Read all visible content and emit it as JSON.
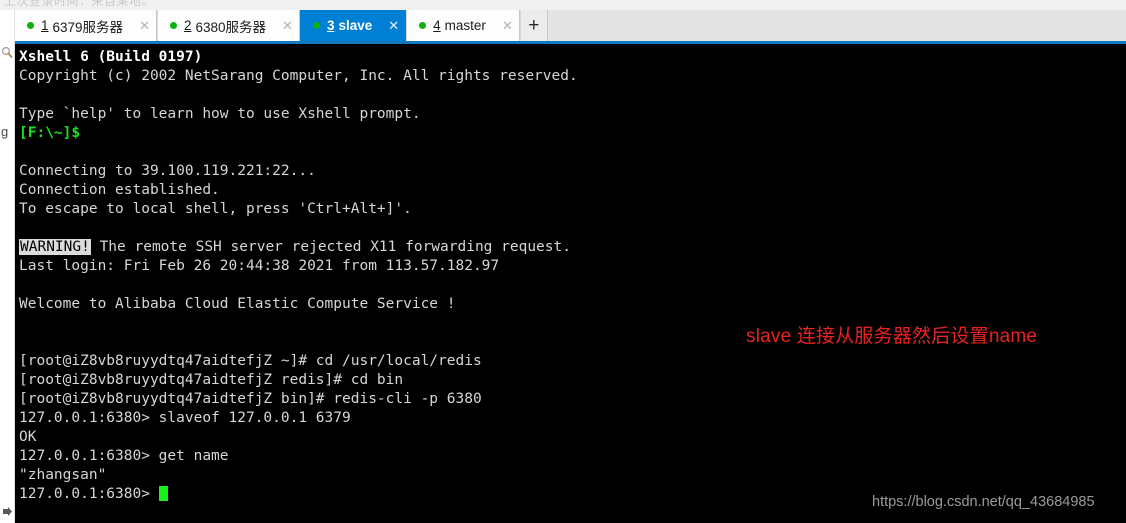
{
  "window": {
    "clipped_top_text": "上次登录时间：来自某地。"
  },
  "left_rail": {
    "search_icon": "search-icon",
    "letter": "g",
    "arrow_icon": "arrow-right-icon"
  },
  "tabs": {
    "items": [
      {
        "number": "1",
        "label": "6379服务器",
        "status": "connected",
        "active": false,
        "close": "✕"
      },
      {
        "number": "2",
        "label": "6380服务器",
        "status": "connected",
        "active": false,
        "close": "✕"
      },
      {
        "number": "3",
        "label": "slave",
        "status": "connected",
        "active": true,
        "close": "✕"
      },
      {
        "number": "4",
        "label": "master",
        "status": "connected",
        "active": false,
        "close": "✕"
      }
    ],
    "new_tab_label": "+",
    "active_tab_color": "#0080d4",
    "status_dot_color": "#0bb20b",
    "underline_color": "#1279c0"
  },
  "terminal": {
    "background": "#000000",
    "foreground": "#d6d6d6",
    "prompt_color": "#19e219",
    "lines": [
      {
        "text": "Xshell 6 (Build 0197)",
        "style": "bold"
      },
      {
        "text": "Copyright (c) 2002 NetSarang Computer, Inc. All rights reserved.",
        "style": "normal"
      },
      {
        "text": "",
        "style": "blank"
      },
      {
        "text": "Type `help' to learn how to use Xshell prompt.",
        "style": "normal"
      },
      {
        "text": "[F:\\~]$",
        "style": "green"
      },
      {
        "text": "",
        "style": "blank"
      },
      {
        "text": "Connecting to 39.100.119.221:22...",
        "style": "normal"
      },
      {
        "text": "Connection established.",
        "style": "normal"
      },
      {
        "text": "To escape to local shell, press 'Ctrl+Alt+]'.",
        "style": "normal"
      },
      {
        "text": "",
        "style": "blank"
      },
      {
        "text": "WARNING!",
        "suffix": " The remote SSH server rejected X11 forwarding request.",
        "style": "warning"
      },
      {
        "text": "Last login: Fri Feb 26 20:44:38 2021 from 113.57.182.97",
        "style": "normal"
      },
      {
        "text": "",
        "style": "blank"
      },
      {
        "text": "Welcome to Alibaba Cloud Elastic Compute Service !",
        "style": "normal"
      },
      {
        "text": "",
        "style": "blank"
      },
      {
        "text": "",
        "style": "blank"
      },
      {
        "text": "[root@iZ8vb8ruyydtq47aidtefjZ ~]# cd /usr/local/redis",
        "style": "normal"
      },
      {
        "text": "[root@iZ8vb8ruyydtq47aidtefjZ redis]# cd bin",
        "style": "normal"
      },
      {
        "text": "[root@iZ8vb8ruyydtq47aidtefjZ bin]# redis-cli -p 6380",
        "style": "normal"
      },
      {
        "text": "127.0.0.1:6380> slaveof 127.0.0.1 6379",
        "style": "normal"
      },
      {
        "text": "OK",
        "style": "normal"
      },
      {
        "text": "127.0.0.1:6380> get name",
        "style": "normal"
      },
      {
        "text": "\"zhangsan\"",
        "style": "normal"
      },
      {
        "text": "127.0.0.1:6380> ",
        "style": "cursor"
      }
    ]
  },
  "annotation": {
    "text": "slave 连接从服务器然后设置name",
    "color": "#e8221f"
  },
  "watermark": {
    "text": "https://blog.csdn.net/qq_43684985"
  }
}
